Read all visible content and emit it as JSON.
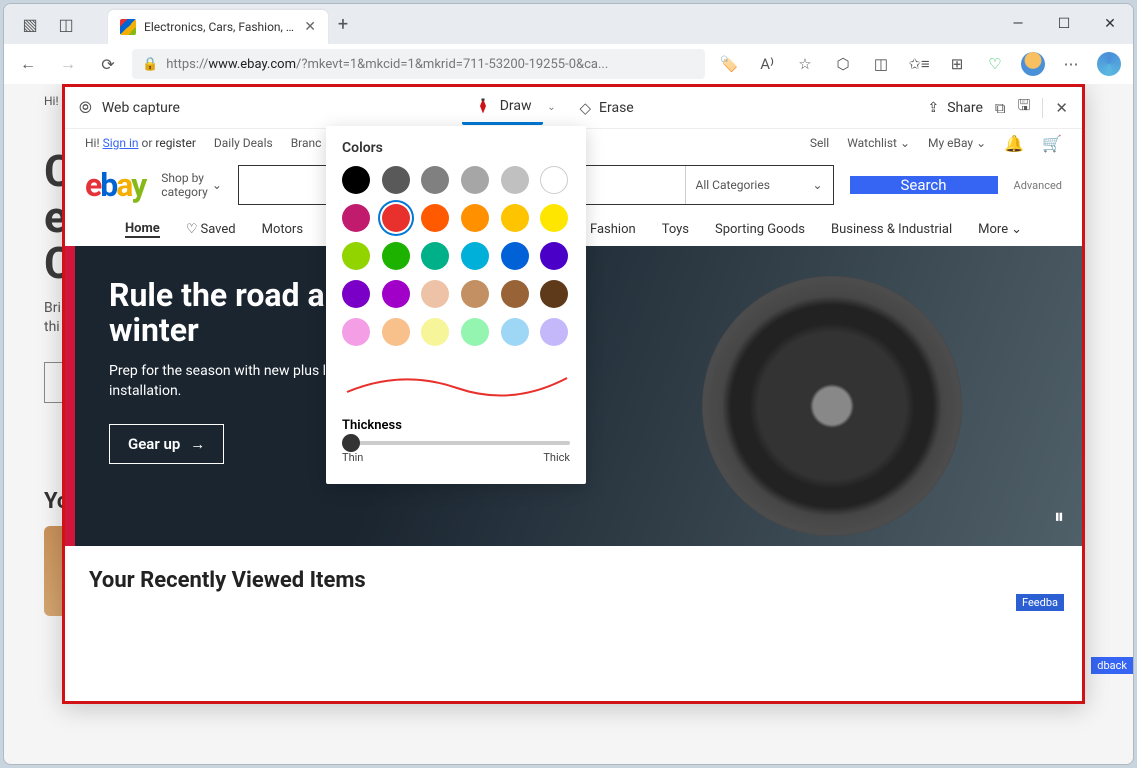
{
  "titlebar": {
    "tab_title": "Electronics, Cars, Fashion, Collect"
  },
  "addrbar": {
    "prefix": "https://",
    "host": "www.ebay.com",
    "rest": "/?mkevt=1&mkcid=1&mkrid=711-53200-19255-0&ca..."
  },
  "capture": {
    "title": "Web capture",
    "draw": "Draw",
    "erase": "Erase",
    "share": "Share"
  },
  "color_panel": {
    "title": "Colors",
    "thickness": "Thickness",
    "thin": "Thin",
    "thick": "Thick",
    "selected": "#e8302c",
    "rows": [
      [
        "#000000",
        "#595959",
        "#808080",
        "#a6a6a6",
        "#c0c0c0",
        "#ffffff"
      ],
      [
        "#c01b6d",
        "#e8302c",
        "#ff5a00",
        "#ff9100",
        "#ffc400",
        "#ffe600"
      ],
      [
        "#92d400",
        "#1db100",
        "#00b089",
        "#00b0d8",
        "#0062d6",
        "#4b00c8"
      ],
      [
        "#7a00c8",
        "#a000c8",
        "#eec2a6",
        "#c29062",
        "#996338",
        "#5e3a1a"
      ],
      [
        "#f39ee5",
        "#f8c08a",
        "#f7f59a",
        "#93f5b0",
        "#9ed6f5",
        "#c4b8fb"
      ]
    ]
  },
  "page": {
    "greeting_prefix": "Hi! ",
    "signin": "Sign in",
    "or": " or ",
    "register": "register",
    "daily_deals": "Daily Deals",
    "brand": "Branc",
    "sell": "Sell",
    "watchlist": "Watchlist",
    "myebay": "My eBay",
    "shopby": "Shop by\ncategory",
    "all_categories": "All Categories",
    "search": "Search",
    "advanced": "Advanced",
    "nav": {
      "home": "Home",
      "saved": "Saved",
      "motors": "Motors",
      "fashion": "Fashion",
      "toys": "Toys",
      "sporting": "Sporting Goods",
      "business": "Business & Industrial",
      "more": "More"
    },
    "hero_title": "Rule the road all winter",
    "hero_sub": "Prep for the season with new plus local installation.",
    "hero_cta": "Gear up",
    "recent": "Your Recently Viewed Items"
  },
  "bg": {
    "greeting": "Hi!",
    "hero1": "C",
    "hero2": "e",
    "hero3": "C",
    "sub": "Bri\nthi",
    "recent": "Yc"
  },
  "feedback": "Feedba",
  "feedback2": "dback"
}
